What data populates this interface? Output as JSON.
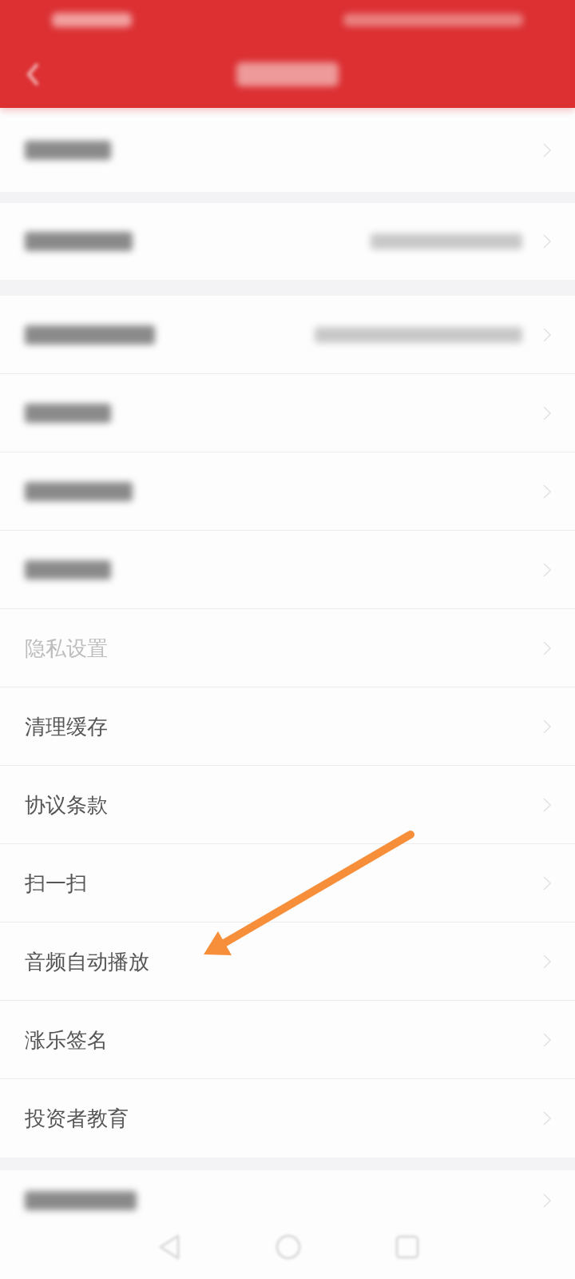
{
  "sections": [
    {
      "items": [
        {
          "kind": "blurred"
        }
      ]
    },
    {
      "items": [
        {
          "kind": "blurred",
          "detail": true
        }
      ]
    },
    {
      "items": [
        {
          "kind": "blurred",
          "detail": true
        },
        {
          "kind": "blurred"
        },
        {
          "kind": "blurred"
        },
        {
          "kind": "blurred"
        },
        {
          "kind": "faded",
          "label": "隐私设置"
        },
        {
          "kind": "text",
          "label": "清理缓存"
        },
        {
          "kind": "text",
          "label": "协议条款"
        },
        {
          "kind": "text",
          "label": "扫一扫"
        },
        {
          "kind": "text",
          "label": "音频自动播放"
        },
        {
          "kind": "text",
          "label": "涨乐签名"
        },
        {
          "kind": "text",
          "label": "投资者教育"
        }
      ]
    },
    {
      "items": [
        {
          "kind": "blurred"
        }
      ]
    }
  ]
}
